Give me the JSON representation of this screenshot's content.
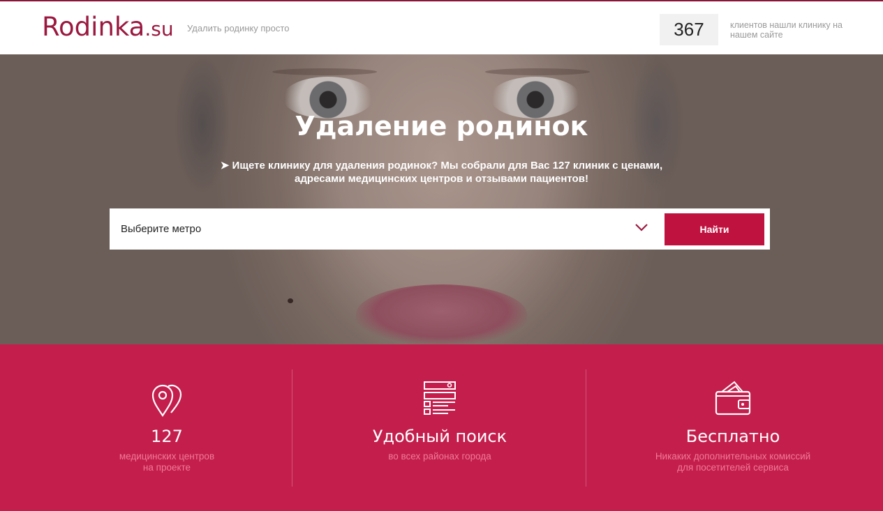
{
  "header": {
    "logo_main": "Rodinka",
    "logo_suffix": ".su",
    "tagline": "Удалить родинку просто",
    "counter_value": "367",
    "counter_label": "клиентов нашли клинику на нашем сайте"
  },
  "hero": {
    "title": "Удаление родинок",
    "subtitle_line1": "➤ Ищете клинику для удаления родинок? Мы собрали для Вас 127 клиник с ценами,",
    "subtitle_line2": "адресами медицинских центров и отзывами пациентов!",
    "search": {
      "select_value": "Выберите метро",
      "button_label": "Найти"
    }
  },
  "features": [
    {
      "icon": "map-pins-icon",
      "title": "127",
      "desc_line1": "медицинских центров",
      "desc_line2": "на проекте"
    },
    {
      "icon": "search-list-icon",
      "title": "Удобный поиск",
      "desc_line1": "во всех районах города",
      "desc_line2": ""
    },
    {
      "icon": "wallet-icon",
      "title": "Бесплатно",
      "desc_line1": "Никаких дополнительных комиссий",
      "desc_line2": "для посетителей сервиса"
    }
  ],
  "colors": {
    "brand": "#9b1840",
    "button": "#c0123f",
    "features_bg": "#c41e4c",
    "features_desc": "#f07a98"
  }
}
